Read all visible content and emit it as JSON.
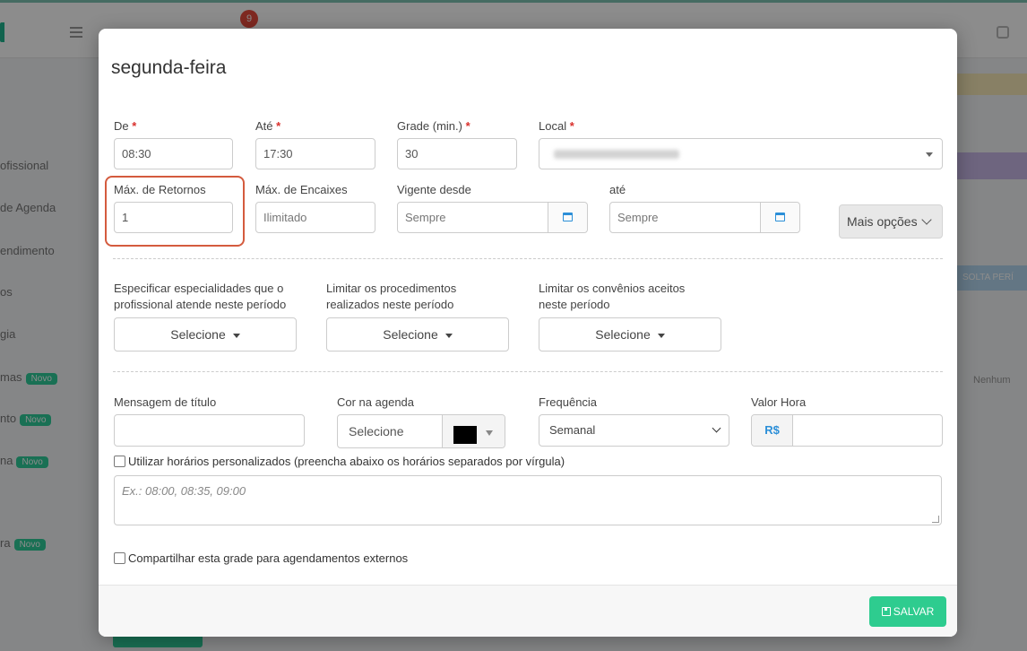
{
  "background": {
    "notification_count": "9",
    "sidebar": [
      {
        "label": "ofissional",
        "badge": ""
      },
      {
        "label": "de Agenda",
        "badge": ""
      },
      {
        "label": "endimento",
        "badge": ""
      },
      {
        "label": "os",
        "badge": ""
      },
      {
        "label": "gia",
        "badge": ""
      },
      {
        "label": "mas",
        "badge": "Novo"
      },
      {
        "label": "nto",
        "badge": "Novo"
      },
      {
        "label": "na",
        "badge": "Novo"
      },
      {
        "label": "ra",
        "badge": "Novo"
      }
    ],
    "right_text": "Nenhum",
    "right_banner": "SOLTA PERÍ"
  },
  "modal": {
    "title": "segunda-feira",
    "required_mark": "*",
    "fields": {
      "de": {
        "label": "De",
        "value": "08:30"
      },
      "ate_hora": {
        "label": "Até",
        "value": "17:30"
      },
      "grade": {
        "label": "Grade (min.)",
        "value": "30"
      },
      "local": {
        "label": "Local",
        "value": "Consultório de Fátima"
      },
      "max_retornos": {
        "label": "Máx. de Retornos",
        "value": "1"
      },
      "max_encaixes": {
        "label": "Máx. de Encaixes",
        "placeholder": "Ilimitado"
      },
      "vigente_desde": {
        "label": "Vigente desde",
        "placeholder": "Sempre"
      },
      "vigente_ate": {
        "label": "até",
        "placeholder": "Sempre"
      }
    },
    "more_options": "Mais opções",
    "filters": [
      {
        "label_line1": "Especificar especialidades que o",
        "label_line2": "profissional atende neste período",
        "button": "Selecione"
      },
      {
        "label_line1": "Limitar os procedimentos",
        "label_line2": "realizados neste período",
        "button": "Selecione"
      },
      {
        "label_line1": "Limitar os convênios aceitos",
        "label_line2": "neste período",
        "button": "Selecione"
      }
    ],
    "mensagem": {
      "label": "Mensagem de título",
      "value": ""
    },
    "cor": {
      "label": "Cor na agenda",
      "selected": "Selecione",
      "swatch_color": "#000000"
    },
    "frequencia": {
      "label": "Frequência",
      "selected": "Semanal"
    },
    "valor_hora": {
      "label": "Valor Hora",
      "currency": "R$",
      "value": ""
    },
    "custom_hours": {
      "label": "Utilizar horários personalizados (preencha abaixo os horários separados por vírgula)",
      "checked": false,
      "placeholder": "Ex.: 08:00, 08:35, 09:00"
    },
    "share": {
      "label": "Compartilhar esta grade para agendamentos externos",
      "checked": false
    },
    "save_label": "SALVAR"
  },
  "colors": {
    "accent_green": "#2ecc8f",
    "required_red": "#d9302c",
    "highlight": "#d45b3e",
    "link_blue": "#2c8fd8"
  }
}
